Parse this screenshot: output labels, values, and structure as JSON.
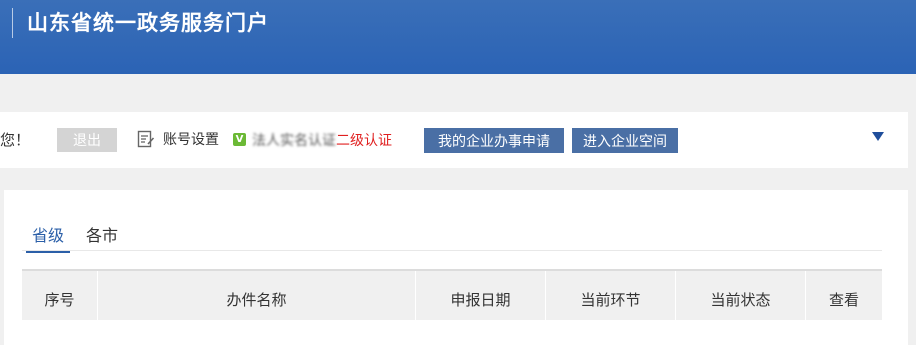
{
  "header": {
    "title": "山东省统一政务服务门户"
  },
  "toolbar": {
    "greeting": "您！",
    "logout_label": "退出",
    "account_settings_label": "账号设置",
    "verified_badge": "V",
    "cert_text_obscured": "法人实名认证",
    "cert_level_text": "二级认证",
    "my_applications_label": "我的企业办事申请",
    "enterprise_space_label": "进入企业空间",
    "colors": {
      "accent": "#4a6fa5",
      "header": "#2b63b5",
      "badge": "#6bb935",
      "cert_red": "#e02020"
    }
  },
  "tabs": [
    {
      "label": "省级",
      "active": true
    },
    {
      "label": "各市",
      "active": false
    }
  ],
  "table": {
    "columns": [
      "序号",
      "办件名称",
      "申报日期",
      "当前环节",
      "当前状态",
      "查看"
    ]
  }
}
